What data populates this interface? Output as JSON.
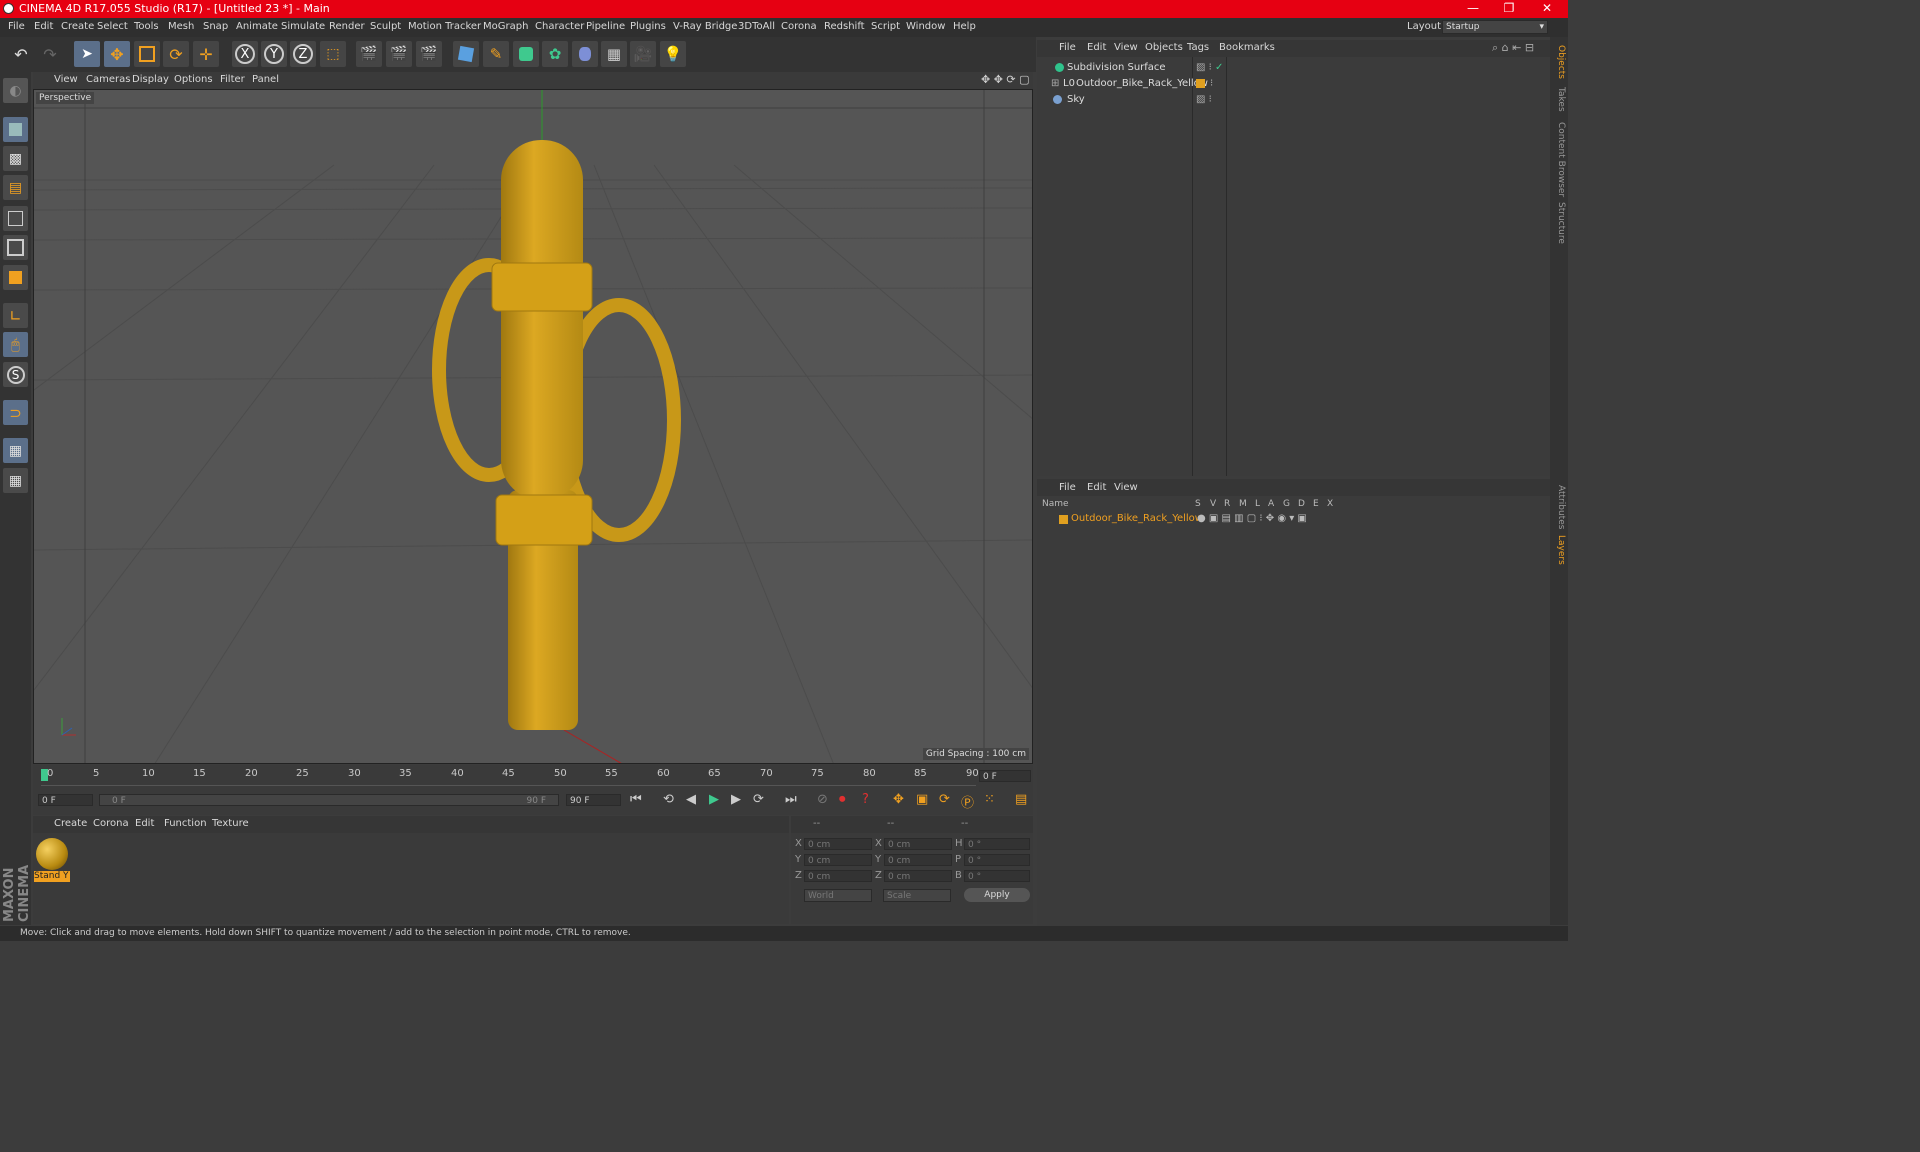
{
  "window": {
    "title": "CINEMA 4D R17.055 Studio (R17) - [Untitled 23 *] - Main",
    "controls": [
      "—",
      "❐",
      "✕"
    ]
  },
  "menubar": {
    "items": [
      "File",
      "Edit",
      "Create",
      "Select",
      "Tools",
      "Mesh",
      "Snap",
      "Animate",
      "Simulate",
      "Render",
      "Sculpt",
      "Motion Tracker",
      "MoGraph",
      "Character",
      "Pipeline",
      "Plugins",
      "V-Ray Bridge",
      "3DToAll",
      "Corona",
      "Redshift",
      "Script",
      "Window",
      "Help"
    ],
    "layout_label": "Layout:",
    "layout_value": "Startup"
  },
  "viewport": {
    "menu": [
      "View",
      "Cameras",
      "Display",
      "Options",
      "Filter",
      "Panel"
    ],
    "label": "Perspective",
    "grid_spacing": "Grid Spacing : 100 cm"
  },
  "object_manager": {
    "menu": [
      "File",
      "Edit",
      "View",
      "Objects",
      "Tags",
      "Bookmarks"
    ],
    "objects": [
      {
        "name": "Subdivision Surface",
        "color": "#2fc38c"
      },
      {
        "name": "Outdoor_Bike_Rack_Yellow",
        "color": "#e0a020"
      },
      {
        "name": "Sky",
        "color": "#7aa0d0"
      }
    ]
  },
  "layer_manager": {
    "menu": [
      "File",
      "Edit",
      "View"
    ],
    "columns": [
      "Name",
      "S",
      "V",
      "R",
      "M",
      "L",
      "A",
      "G",
      "D",
      "E",
      "X"
    ],
    "layer_name": "Outdoor_Bike_Rack_Yellow",
    "layer_color": "#e0a020"
  },
  "right_tabs": [
    "Objects",
    "Takes",
    "Content Browser",
    "Structure",
    "Attributes",
    "Layers"
  ],
  "timeline": {
    "ticks": [
      "0",
      "5",
      "10",
      "15",
      "20",
      "25",
      "30",
      "35",
      "40",
      "45",
      "50",
      "55",
      "60",
      "65",
      "70",
      "75",
      "80",
      "85",
      "90"
    ],
    "current_frame": "0 F",
    "start_field": "0 F",
    "range_start": "0 F",
    "range_end": "90 F",
    "end_field": "90 F"
  },
  "material_manager": {
    "menu": [
      "Create",
      "Corona",
      "Edit",
      "Function",
      "Texture"
    ],
    "material_name": "Stand Y"
  },
  "coordinates": {
    "header": [
      "--",
      "--",
      "--"
    ],
    "rows": [
      {
        "a": "X",
        "av": "0 cm",
        "b": "X",
        "bv": "0 cm",
        "c": "H",
        "cv": "0 °"
      },
      {
        "a": "Y",
        "av": "0 cm",
        "b": "Y",
        "bv": "0 cm",
        "c": "P",
        "cv": "0 °"
      },
      {
        "a": "Z",
        "av": "0 cm",
        "b": "Z",
        "bv": "0 cm",
        "c": "B",
        "cv": "0 °"
      }
    ],
    "mode1": "World",
    "mode2": "Scale",
    "apply": "Apply"
  },
  "status": "Move: Click and drag to move elements. Hold down SHIFT to quantize movement / add to the selection in point mode, CTRL to remove.",
  "brand": "MAXON CINEMA 4D",
  "colors": {
    "title_bar": "#e60012",
    "accent": "#e0a020",
    "object_yellow": "#d4a017"
  }
}
